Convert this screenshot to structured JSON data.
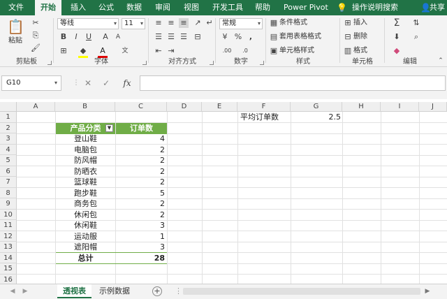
{
  "ribbon_tabs": [
    "文件",
    "开始",
    "插入",
    "公式",
    "数据",
    "审阅",
    "视图",
    "开发工具",
    "帮助",
    "Power Pivot"
  ],
  "tellme": "操作说明搜索",
  "share": "共享",
  "clipboard": {
    "paste": "粘贴",
    "label": "剪贴板"
  },
  "font": {
    "name": "等线",
    "size": "11",
    "label": "字体",
    "bold": "B",
    "italic": "I",
    "underline": "U",
    "color_letter": "A"
  },
  "alignment": {
    "label": "对齐方式"
  },
  "number": {
    "format": "常规",
    "label": "数字",
    "percent": "%",
    "comma": ","
  },
  "styles": {
    "conditional": "条件格式",
    "table": "套用表格格式",
    "cell": "单元格样式",
    "label": "样式"
  },
  "cells": {
    "insert": "插入",
    "delete": "删除",
    "format": "格式",
    "label": "单元格"
  },
  "editing": {
    "label": "编辑",
    "sigma": "Σ"
  },
  "namebox": "G10",
  "fx": "fx",
  "columns": [
    "A",
    "B",
    "C",
    "D",
    "E",
    "F",
    "G",
    "H",
    "I",
    "J"
  ],
  "rows": [
    "1",
    "2",
    "3",
    "4",
    "5",
    "6",
    "7",
    "8",
    "9",
    "10",
    "11",
    "12",
    "13",
    "14",
    "15",
    "16"
  ],
  "table": {
    "headers": [
      "产品分类",
      "订单数"
    ],
    "rows": [
      [
        "登山鞋",
        "4"
      ],
      [
        "电脑包",
        "2"
      ],
      [
        "防风帽",
        "2"
      ],
      [
        "防晒衣",
        "2"
      ],
      [
        "篮球鞋",
        "2"
      ],
      [
        "跑步鞋",
        "5"
      ],
      [
        "商务包",
        "2"
      ],
      [
        "休闲包",
        "2"
      ],
      [
        "休闲鞋",
        "3"
      ],
      [
        "运动服",
        "1"
      ],
      [
        "遮阳帽",
        "3"
      ]
    ],
    "total_label": "总计",
    "total_value": "28"
  },
  "avg": {
    "label": "平均订单数",
    "value": "2.5"
  },
  "sheets": [
    "透视表",
    "示例数据"
  ],
  "colors": {
    "excel_green": "#217346",
    "table_header": "#70ad47"
  }
}
